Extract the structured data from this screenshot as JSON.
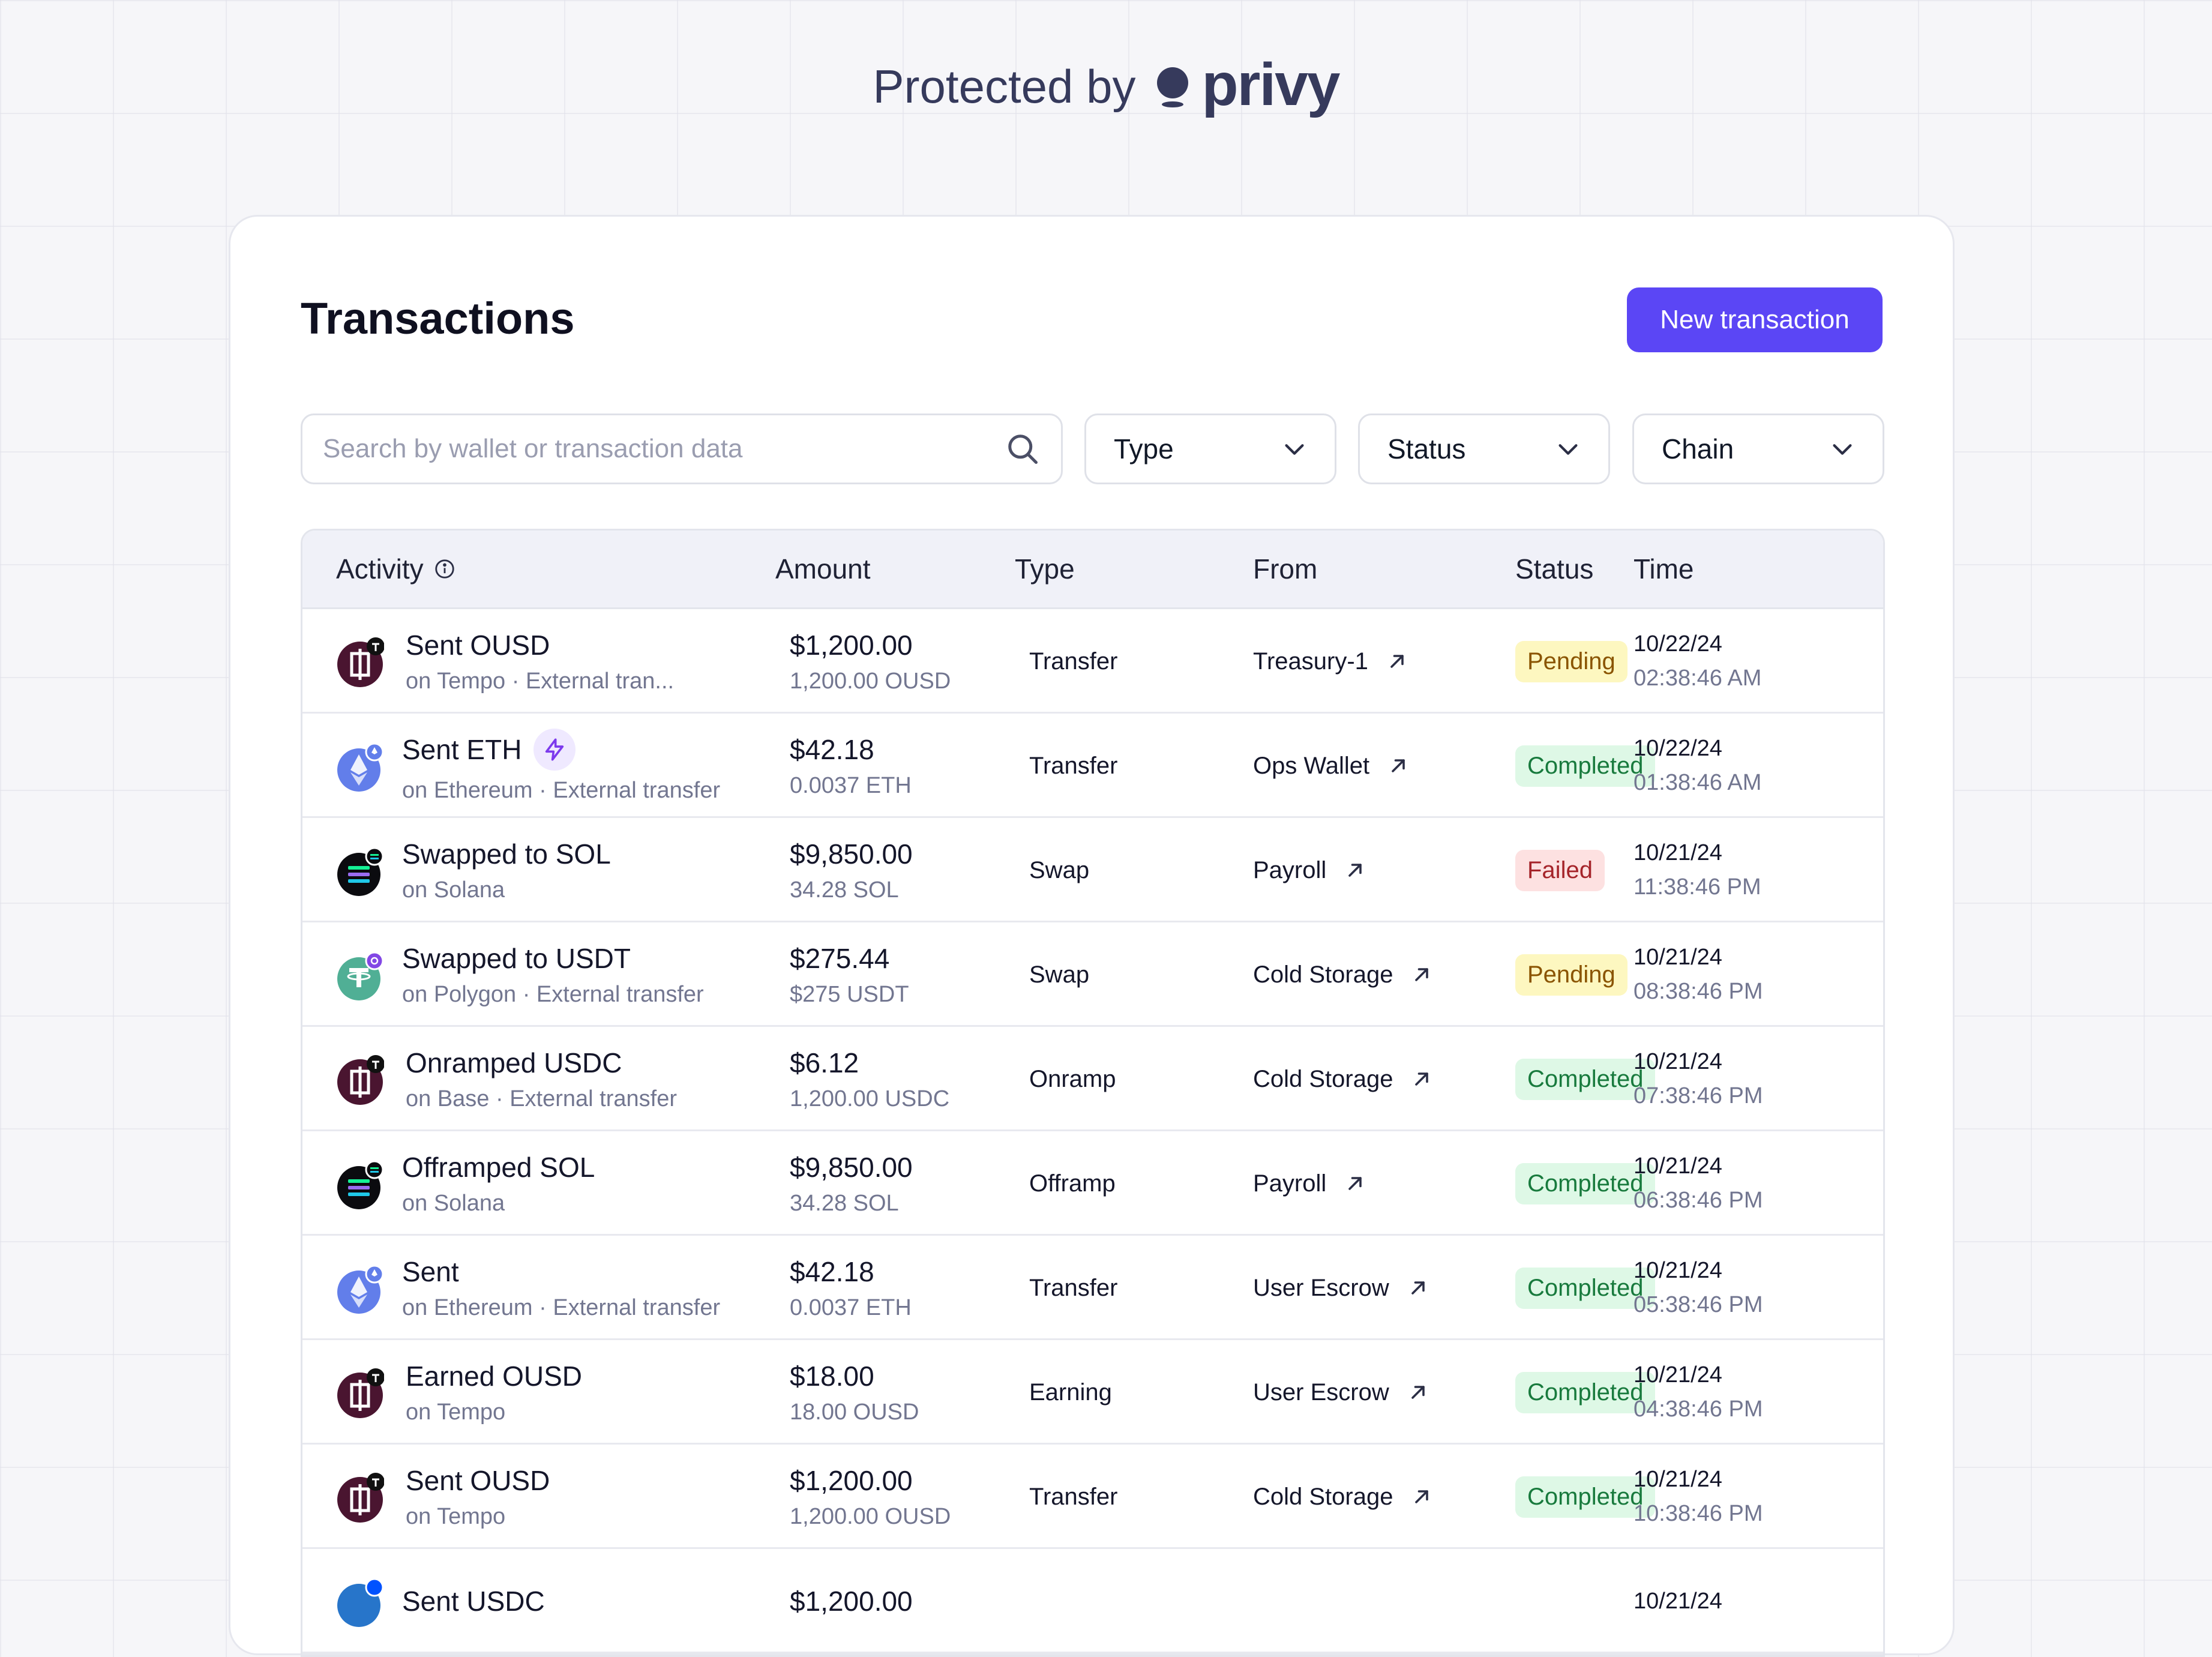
{
  "header": {
    "protected_label": "Protected by",
    "brand": "privy"
  },
  "page": {
    "title": "Transactions",
    "new_button": "New transaction"
  },
  "search": {
    "placeholder": "Search by wallet or transaction data"
  },
  "filters": {
    "type": "Type",
    "status": "Status",
    "chain": "Chain"
  },
  "table": {
    "columns": {
      "activity": "Activity",
      "amount": "Amount",
      "type": "Type",
      "from": "From",
      "status": "Status",
      "time": "Time"
    },
    "rows": [
      {
        "icon": "ousd",
        "title": "Sent OUSD",
        "subtitle": "on Tempo · External tran...",
        "amount": "$1,200.00",
        "amount_sub": "1,200.00 OUSD",
        "type": "Transfer",
        "from": "Treasury-1",
        "status": "Pending",
        "date": "10/22/24",
        "time": "02:38:46 AM"
      },
      {
        "icon": "eth",
        "title": "Sent ETH",
        "bolt": true,
        "subtitle": "on Ethereum · External transfer",
        "amount": "$42.18",
        "amount_sub": "0.0037 ETH",
        "type": "Transfer",
        "from": "Ops Wallet",
        "status": "Completed",
        "date": "10/22/24",
        "time": "01:38:46 AM"
      },
      {
        "icon": "sol",
        "title": "Swapped to SOL",
        "subtitle": "on Solana",
        "amount": "$9,850.00",
        "amount_sub": "34.28 SOL",
        "type": "Swap",
        "from": "Payroll",
        "status": "Failed",
        "date": "10/21/24",
        "time": "11:38:46 PM"
      },
      {
        "icon": "usdt",
        "title": "Swapped to USDT",
        "subtitle": "on Polygon · External transfer",
        "amount": "$275.44",
        "amount_sub": "$275 USDT",
        "type": "Swap",
        "from": "Cold Storage",
        "status": "Pending",
        "date": "10/21/24",
        "time": "08:38:46 PM"
      },
      {
        "icon": "ousd",
        "title": "Onramped USDC",
        "subtitle": "on Base · External transfer",
        "amount": "$6.12",
        "amount_sub": "1,200.00 USDC",
        "type": "Onramp",
        "from": "Cold Storage",
        "status": "Completed",
        "date": "10/21/24",
        "time": "07:38:46 PM"
      },
      {
        "icon": "sol",
        "title": "Offramped SOL",
        "subtitle": "on Solana",
        "amount": "$9,850.00",
        "amount_sub": "34.28 SOL",
        "type": "Offramp",
        "from": "Payroll",
        "status": "Completed",
        "date": "10/21/24",
        "time": "06:38:46 PM"
      },
      {
        "icon": "eth",
        "title": "Sent",
        "subtitle": "on Ethereum · External transfer",
        "amount": "$42.18",
        "amount_sub": "0.0037 ETH",
        "type": "Transfer",
        "from": "User Escrow",
        "status": "Completed",
        "date": "10/21/24",
        "time": "05:38:46 PM"
      },
      {
        "icon": "ousd",
        "title": "Earned OUSD",
        "subtitle": "on Tempo",
        "amount": "$18.00",
        "amount_sub": "18.00 OUSD",
        "type": "Earning",
        "from": "User Escrow",
        "status": "Completed",
        "date": "10/21/24",
        "time": "04:38:46 PM"
      },
      {
        "icon": "ousd",
        "title": "Sent OUSD",
        "subtitle": "on Tempo",
        "amount": "$1,200.00",
        "amount_sub": "1,200.00 OUSD",
        "type": "Transfer",
        "from": "Cold Storage",
        "status": "Completed",
        "date": "10/21/24",
        "time": "10:38:46 PM"
      },
      {
        "icon": "usdc",
        "title": "Sent USDC",
        "subtitle": "",
        "amount": "$1,200.00",
        "amount_sub": "",
        "type": "",
        "from": "",
        "status": "",
        "date": "10/21/24",
        "time": ""
      }
    ]
  },
  "colors": {
    "accent": "#5b46f5",
    "pending_bg": "#fdf7c0",
    "completed_bg": "#def8e6",
    "failed_bg": "#fde1e1"
  }
}
